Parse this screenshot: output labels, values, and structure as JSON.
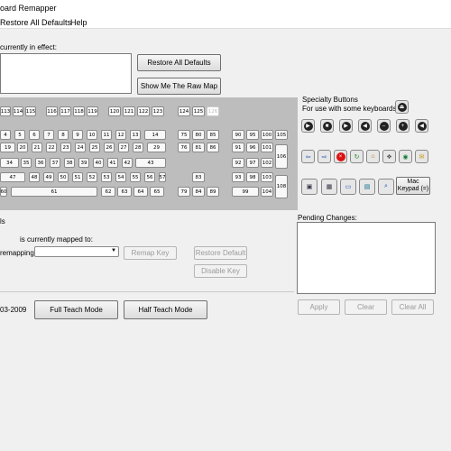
{
  "window": {
    "title": "oard Remapper"
  },
  "menu": {
    "items": [
      "Restore All Defaults",
      "Help"
    ]
  },
  "current": {
    "label": "currently in effect:",
    "restore_all_defaults": "Restore All Defaults",
    "show_raw_map": "Show Me The Raw Map"
  },
  "keyboard": {
    "rows": [
      [
        "113",
        "114",
        "115",
        "116",
        "117",
        "118",
        "119",
        "120",
        "121",
        "122",
        "123",
        "124",
        "125",
        "126"
      ],
      [
        "4",
        "5",
        "6",
        "7",
        "8",
        "9",
        "10",
        "11",
        "12",
        "13",
        "14"
      ],
      [
        "19",
        "20",
        "21",
        "22",
        "23",
        "24",
        "25",
        "26",
        "27",
        "28",
        "29"
      ],
      [
        "34",
        "35",
        "36",
        "37",
        "38",
        "39",
        "40",
        "41",
        "42",
        "43"
      ],
      [
        "47",
        "48",
        "49",
        "50",
        "51",
        "52",
        "53",
        "54",
        "55",
        "56",
        "57"
      ],
      [
        "60",
        "61",
        "62",
        "63",
        "64",
        "65"
      ],
      [
        "75",
        "80",
        "85",
        "76",
        "81",
        "86"
      ],
      [
        "83",
        "79",
        "84",
        "89"
      ],
      [
        "90",
        "95",
        "100",
        "105",
        "91",
        "96",
        "101",
        "92",
        "97",
        "102",
        "106",
        "93",
        "98",
        "103",
        "99",
        "104",
        "108"
      ]
    ]
  },
  "special": {
    "title": "Specialty Buttons",
    "subtitle": "For use with some keyboards",
    "mac_keypad": "Mac Keypad (=)"
  },
  "mapping": {
    "section_label": "ls",
    "mapped_to": "is currently mapped to:",
    "remapping": "remapping",
    "remap_key": "Remap Key",
    "restore_default": "Restore Default",
    "disable_key": "Disable Key"
  },
  "pending": {
    "label": "Pending Changes:",
    "apply": "Apply",
    "clear": "Clear",
    "clear_all": "Clear All"
  },
  "footer": {
    "copyright": "03-2009",
    "full_teach": "Full Teach Mode",
    "half_teach": "Half Teach Mode"
  }
}
